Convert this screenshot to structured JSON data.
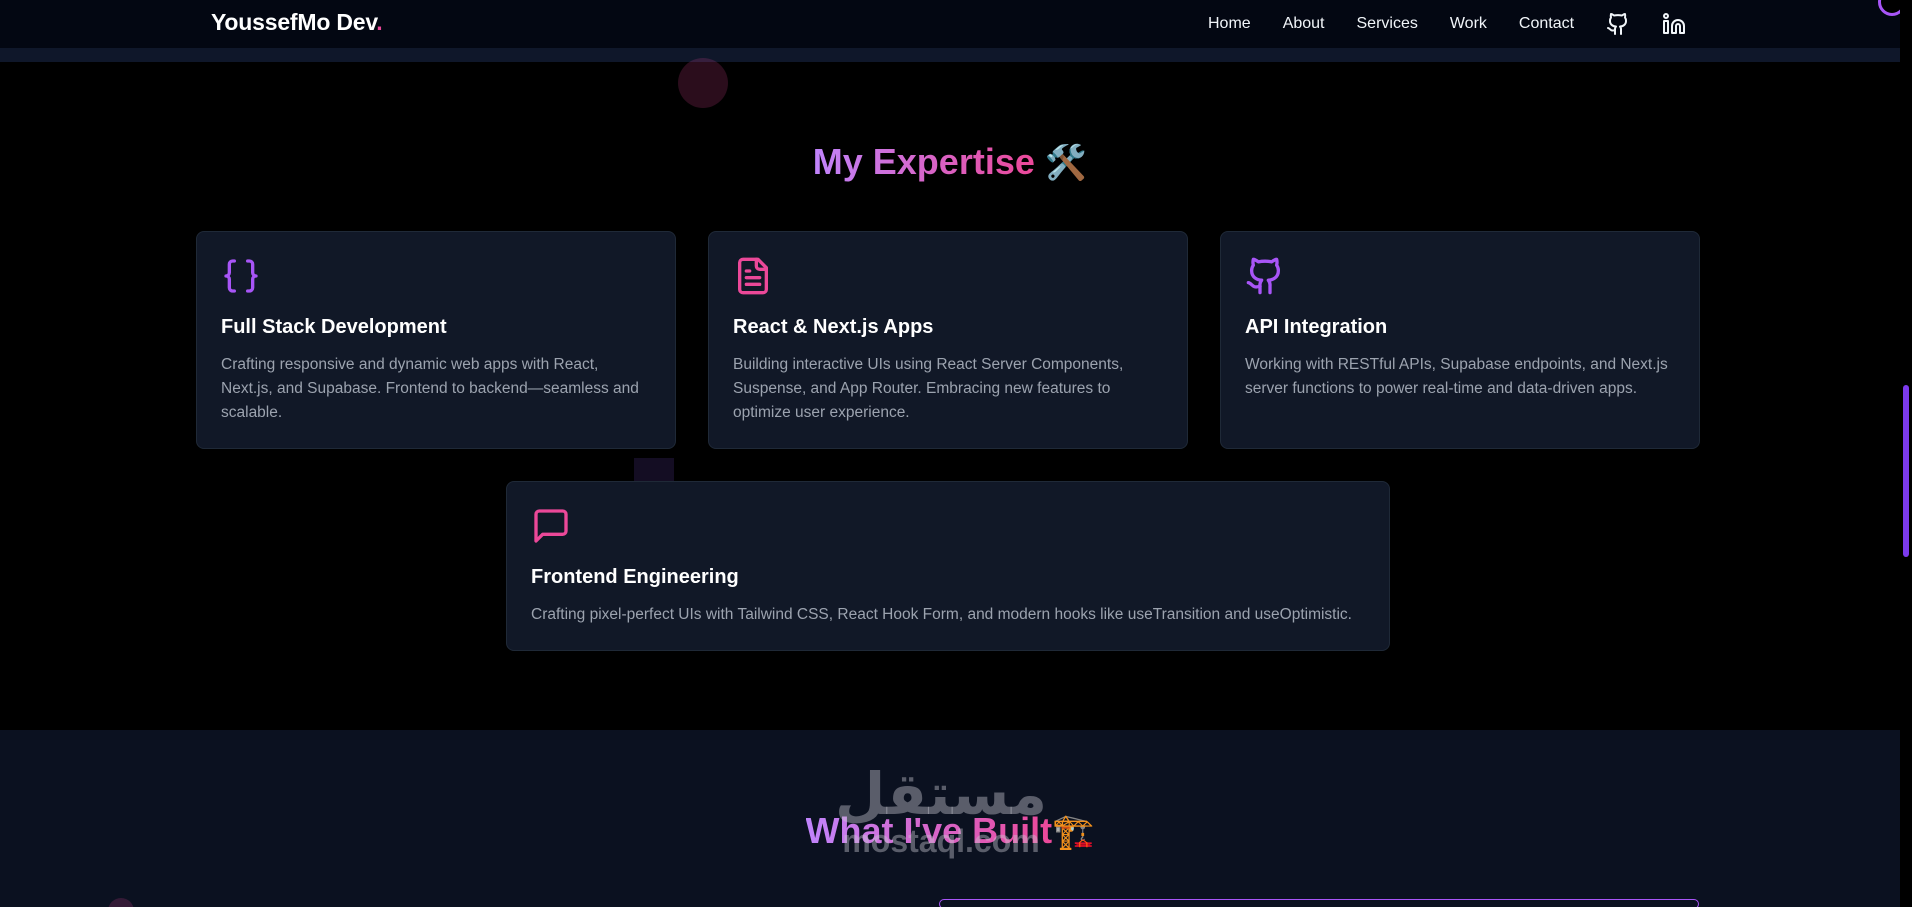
{
  "nav": {
    "logo": "YoussefMo Dev",
    "logo_dot": ".",
    "links": [
      "Home",
      "About",
      "Services",
      "Work",
      "Contact"
    ],
    "icons": [
      "github-icon",
      "linkedin-icon"
    ]
  },
  "expertise": {
    "title": "My Expertise",
    "title_emoji": "🛠️",
    "cards": [
      {
        "icon": "braces-icon",
        "title": "Full Stack Development",
        "desc": "Crafting responsive and dynamic web apps with React, Next.js, and Supabase. Frontend to backend—seamless and scalable."
      },
      {
        "icon": "document-icon",
        "title": "React & Next.js Apps",
        "desc": "Building interactive UIs using React Server Components, Suspense, and App Router. Embracing new features to optimize user experience."
      },
      {
        "icon": "github-icon",
        "title": "API Integration",
        "desc": "Working with RESTful APIs, Supabase endpoints, and Next.js server functions to power real-time and data-driven apps."
      },
      {
        "icon": "message-icon",
        "title": "Frontend Engineering",
        "desc": "Crafting pixel-perfect UIs with Tailwind CSS, React Hook Form, and modern hooks like useTransition and useOptimistic."
      }
    ]
  },
  "built": {
    "title": "What I've Built",
    "title_emoji": "🏗️"
  },
  "watermark": {
    "arabic": "مستقل",
    "latin": "mostaql.com"
  },
  "colors": {
    "accent_purple": "#a855f7",
    "accent_pink": "#ec4899",
    "card_bg": "#111827"
  }
}
